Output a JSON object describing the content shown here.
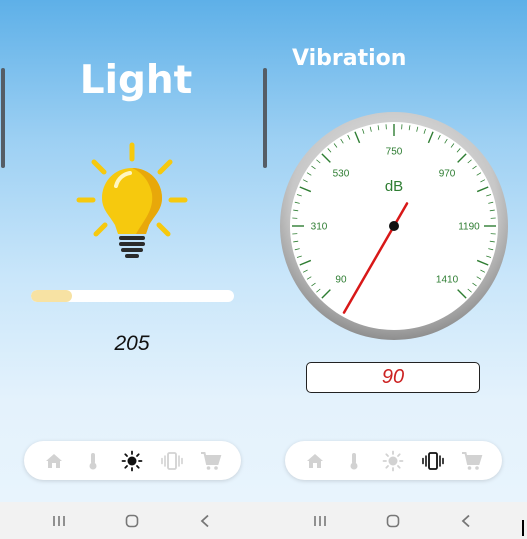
{
  "left_panel": {
    "title": "Light",
    "progress_fraction": 0.2,
    "value": "205",
    "colors": {
      "progress_fill": "#f7e2a3",
      "bulb": "#f6c90e",
      "rays": "#f6c90e"
    }
  },
  "right_panel": {
    "title": "Vibration",
    "gauge": {
      "unit": "dB",
      "tick_labels": [
        "90",
        "310",
        "530",
        "750",
        "970",
        "1190",
        "1410"
      ],
      "needle_value": 90,
      "needle_color": "#d81818"
    },
    "value": "90",
    "value_color": "#cc2222"
  },
  "left_nav": {
    "items": [
      {
        "icon": "home-icon",
        "active": false
      },
      {
        "icon": "thermometer-icon",
        "active": false
      },
      {
        "icon": "sun-icon",
        "active": true
      },
      {
        "icon": "vibration-icon",
        "active": false
      },
      {
        "icon": "cart-icon",
        "active": false
      }
    ]
  },
  "right_nav": {
    "items": [
      {
        "icon": "home-icon",
        "active": false
      },
      {
        "icon": "thermometer-icon",
        "active": false
      },
      {
        "icon": "sun-icon",
        "active": false
      },
      {
        "icon": "vibration-icon",
        "active": true
      },
      {
        "icon": "cart-icon",
        "active": false
      }
    ]
  },
  "system_bar": {
    "buttons": [
      "recent-apps-icon",
      "home-circle-icon",
      "back-icon"
    ]
  }
}
